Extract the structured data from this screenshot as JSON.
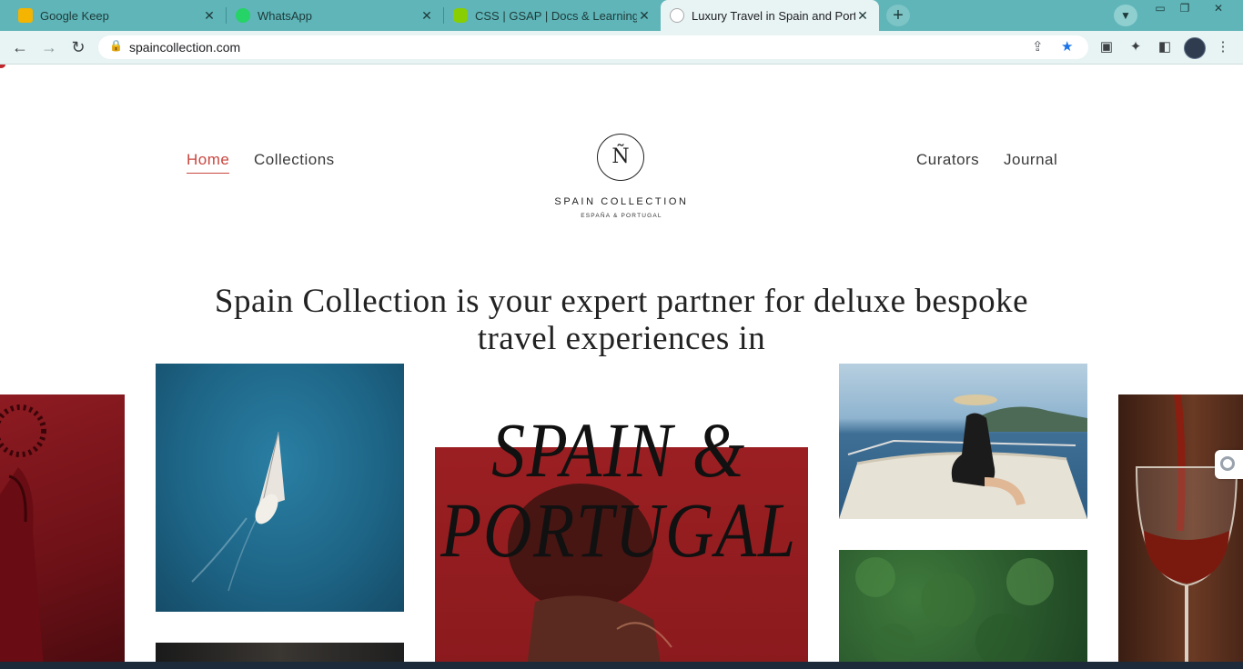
{
  "browser": {
    "tabs": [
      {
        "label": "Google Keep",
        "favicon_color": "#f4b400"
      },
      {
        "label": "WhatsApp",
        "favicon_color": "#25d366"
      },
      {
        "label": "CSS | GSAP | Docs & Learning",
        "favicon_color": "#88ce02"
      },
      {
        "label": "Luxury Travel in Spain and Portug",
        "favicon_color": "#d9d9d9"
      }
    ],
    "new_tab_label": "+",
    "url": "spaincollection.com",
    "accent": "#5fb5b8"
  },
  "site": {
    "nav_left": [
      "Home",
      "Collections"
    ],
    "nav_right": [
      "Curators",
      "Journal"
    ],
    "logo_mark": "Ñ",
    "logo_name": "SPAIN COLLECTION",
    "logo_tagline": "ESPAÑA & PORTUGAL",
    "headline": "Spain Collection is your expert partner for deluxe bespoke travel experiences in",
    "hero_title_line1": "SPAIN &",
    "hero_title_line2": "PORTUGAL",
    "accent_color": "#c9463f"
  }
}
